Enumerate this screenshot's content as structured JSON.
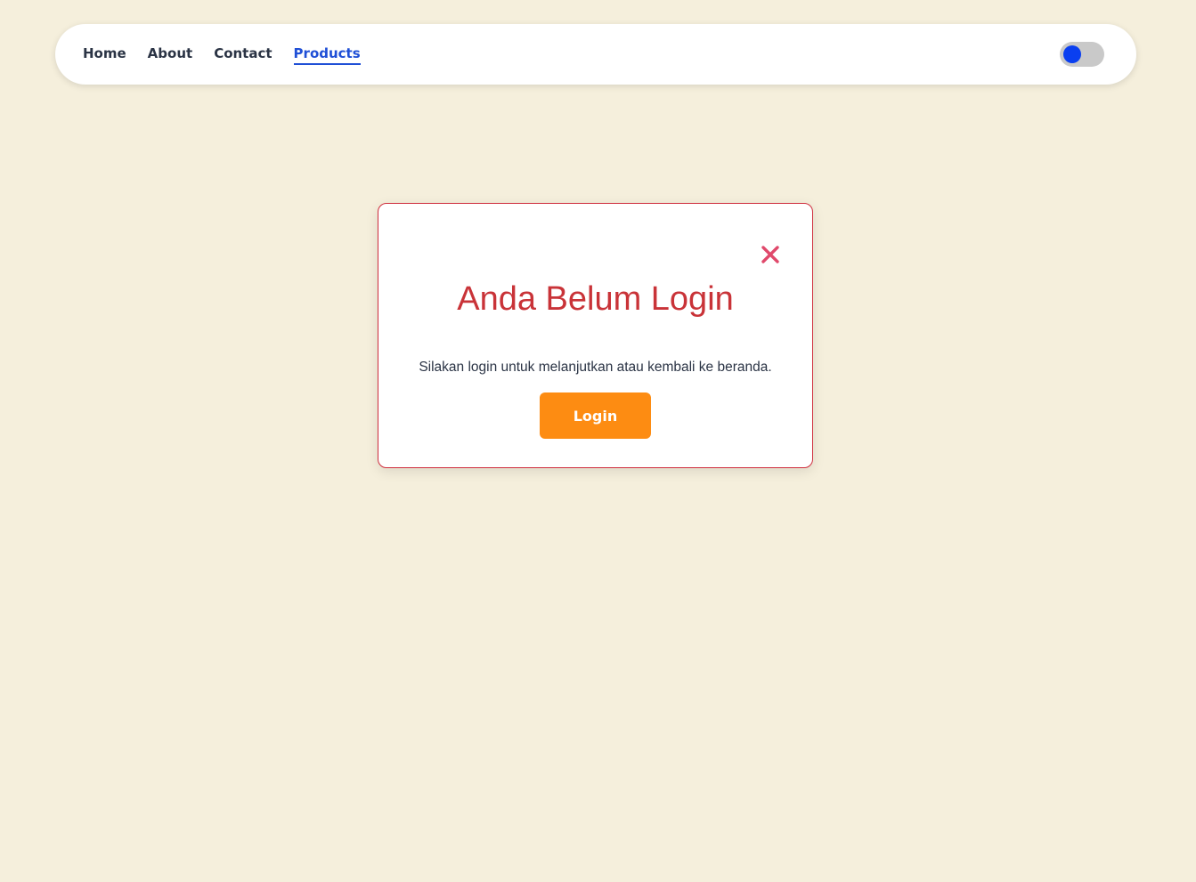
{
  "nav": {
    "links": [
      {
        "label": "Home",
        "active": false
      },
      {
        "label": "About",
        "active": false
      },
      {
        "label": "Contact",
        "active": false
      },
      {
        "label": "Products",
        "active": true
      }
    ],
    "theme_toggle": {
      "state": "off",
      "icon": "toggle-icon"
    }
  },
  "modal": {
    "title": "Anda Belum Login",
    "message": "Silakan login untuk melanjutkan atau kembali ke beranda.",
    "login_label": "Login",
    "close_icon": "close-icon"
  },
  "colors": {
    "background": "#f5efdc",
    "active_link": "#1f4fd6",
    "toggle_knob": "#0a3ff0",
    "modal_border": "#cf2e3d",
    "title": "#c93338",
    "close_icon": "#e0496b",
    "login_button": "#fd8c12"
  }
}
